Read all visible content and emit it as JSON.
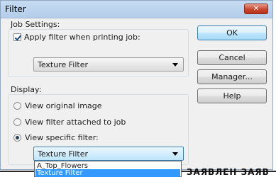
{
  "window": {
    "title": "Filter",
    "close_label": "✕"
  },
  "job_settings": {
    "label": "Job Settings:",
    "apply_filter_label": "Apply filter when printing job:",
    "apply_filter_checked": true,
    "filter_select_value": "Texture Filter"
  },
  "display": {
    "label": "Display:",
    "options": [
      {
        "label": "View original image",
        "checked": false
      },
      {
        "label": "View filter attached to job",
        "checked": false
      },
      {
        "label": "View specific filter:",
        "checked": true
      }
    ],
    "specific_select_value": "Texture Filter",
    "dropdown_options": [
      "A_Top_Flowers",
      "Texture Filter"
    ],
    "dropdown_selected": "Texture Filter"
  },
  "buttons": {
    "ok": "OK",
    "cancel": "Cancel",
    "manager": "Manager...",
    "help": "Help"
  },
  "background_text": "ЗАЯВЛЕН ЗАЯВ"
}
